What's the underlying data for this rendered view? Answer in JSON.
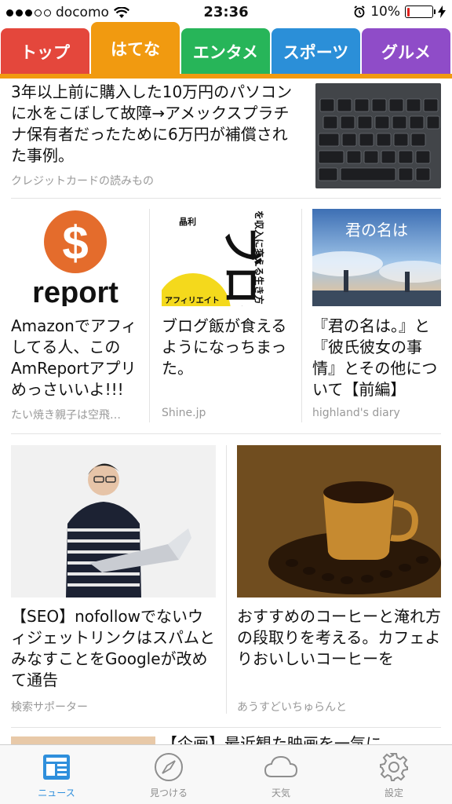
{
  "status_bar": {
    "carrier": "docomo",
    "time": "23:36",
    "battery_percent": "10%",
    "battery_level": 0.1,
    "battery_color": "#e0201c"
  },
  "tabs": [
    {
      "label": "トップ",
      "color": "#e4473c"
    },
    {
      "label": "はてな",
      "color": "#f19a10",
      "active": true
    },
    {
      "label": "エンタメ",
      "color": "#27b559"
    },
    {
      "label": "スポーツ",
      "color": "#2b8fd8"
    },
    {
      "label": "グルメ",
      "color": "#8f4cc8"
    }
  ],
  "articles": [
    {
      "title": "3年以上前に購入した10万円のパソコンに水をこぼして故障→アメックスプラチナ保有者だったために6万円が補償された事例。",
      "source": "クレジットカードの読みもの",
      "image": "laptop-keyboard"
    },
    {
      "title": "Amazonでアフィしてる人、このAmReportアプリめっさいいよ!!!",
      "source": "たい焼き親子は空飛…",
      "image": "report-logo",
      "image_text": "report"
    },
    {
      "title": "ブログ飯が食えるようになっちまった。",
      "source": "Shine.jp",
      "image": "book-cover",
      "image_text": "ブログ",
      "image_subtext": "を収入に変える生き方",
      "image_author": "晶利",
      "image_tag": "アフィリエイト"
    },
    {
      "title": "『君の名は。』と『彼氏彼女の事情』とその他について【前編】",
      "source": "highland's diary",
      "image": "anime-poster",
      "image_text": "君の名は"
    },
    {
      "title": "【SEO】nofollowでないウィジェットリンクはスパムとみなすことをGoogleが改めて通告",
      "source": "検索サポーター",
      "image": "man-with-laptop"
    },
    {
      "title": "おすすめのコーヒーと淹れ方の段取りを考える。カフェよりおいしいコーヒーを",
      "source": "あうすどいちゅらんと",
      "image": "coffee-cup"
    },
    {
      "title": "【企画】最近観た映画を一気に",
      "image": "partial-thumbnail"
    }
  ],
  "tab_bar": [
    {
      "label": "ニュース",
      "icon": "news-icon",
      "active": true
    },
    {
      "label": "見つける",
      "icon": "compass-icon"
    },
    {
      "label": "天気",
      "icon": "cloud-icon"
    },
    {
      "label": "設定",
      "icon": "gear-icon"
    }
  ],
  "colors": {
    "accent": "#f19a10",
    "active_tab_bar": "#2f8fdc",
    "inactive_tab_bar": "#8e8e8e"
  }
}
